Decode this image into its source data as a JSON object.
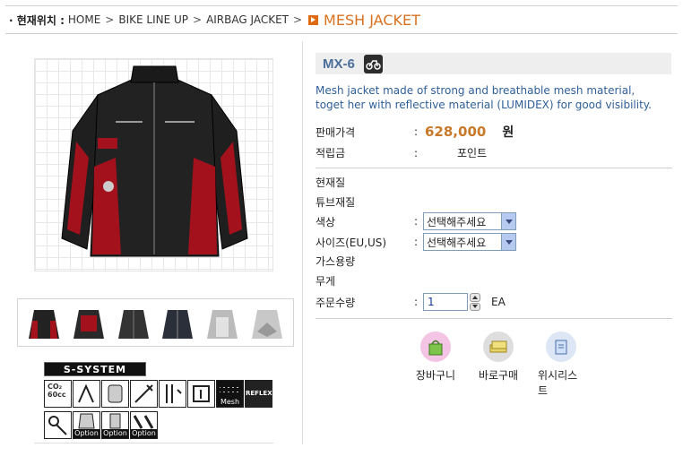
{
  "breadcrumb": {
    "label": "· 현재위치 :",
    "items": [
      "HOME",
      "BIKE LINE UP",
      "AIRBAG JACKET"
    ],
    "separator": ">",
    "current": "MESH JACKET"
  },
  "product": {
    "model": "MX-6",
    "description": "Mesh jacket made of strong and breathable mesh material, toget her with reflective material (LUMIDEX) for good visibility.",
    "price_label": "판매가격",
    "price_value": "628,000",
    "currency": "원",
    "points_label": "적립금",
    "points_value": "포인트",
    "material_label": "현재질",
    "tube_label": "튜브재질",
    "color_label": "색상",
    "color_select": "선택해주세요",
    "size_label": "사이즈(EU,US)",
    "size_select": "선택해주세요",
    "gas_label": "가스용량",
    "weight_label": "무게",
    "qty_label": "주문수량",
    "qty_value": "1",
    "qty_unit": "EA",
    "colon": ":"
  },
  "features": {
    "system_logo": "S-SYSTEM",
    "row1": [
      {
        "icon": "co2-cartridge-icon",
        "text": "CO₂ 60cc"
      },
      {
        "icon": "airbag-icon",
        "text": ""
      },
      {
        "icon": "jacket-protector-icon",
        "text": ""
      },
      {
        "icon": "tool-icon",
        "text": ""
      },
      {
        "icon": "cord-icon",
        "text": ""
      },
      {
        "icon": "connector-icon",
        "text": ""
      },
      {
        "icon": "mesh-icon",
        "text": "Mesh"
      },
      {
        "icon": "reflex-icon",
        "text": "REFLEX"
      }
    ],
    "row2": [
      {
        "icon": "lanyard-icon",
        "text": ""
      },
      {
        "icon": "vest-option-icon",
        "text": "Option"
      },
      {
        "icon": "back-option-icon",
        "text": "Option"
      },
      {
        "icon": "pads-option-icon",
        "text": "Option"
      }
    ]
  },
  "actions": {
    "cart": "장바구니",
    "buy_now": "바로구매",
    "wishlist": "위시리스트"
  },
  "colors": {
    "accent": "#d9711f",
    "model_blue": "#4a6f9a",
    "desc_blue": "#2f5f96",
    "price": "#c8792a"
  }
}
